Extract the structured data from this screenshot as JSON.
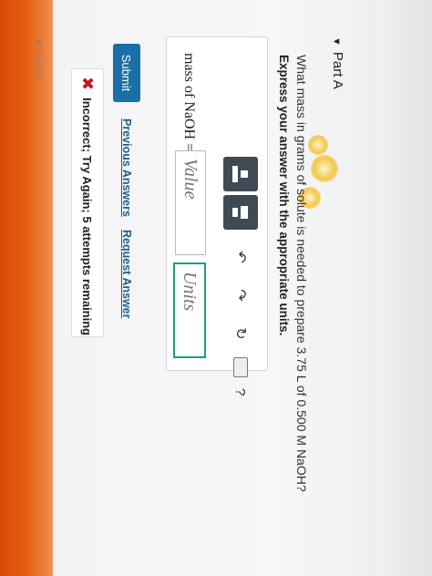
{
  "part_a": {
    "label": "Part A"
  },
  "question": {
    "text": "What mass in grams of solute is needed to prepare 3.75 L of 0.500 M NaOH?",
    "instruction": "Express your answer with the appropriate units."
  },
  "toolbar": {
    "template_icon": "templates-icon",
    "undo_icon": "undo-icon",
    "redo_icon": "redo-icon",
    "reset_icon": "reset-icon",
    "keyboard_icon": "keyboard-icon",
    "help_label": "?"
  },
  "answer": {
    "field_label": "mass of NaOH =",
    "value_placeholder": "Value",
    "units_placeholder": "Units"
  },
  "actions": {
    "submit_label": "Submit",
    "previous_answers_label": "Previous Answers",
    "request_answer_label": "Request Answer"
  },
  "feedback": {
    "text": "Incorrect; Try Again; 5 attempts remaining"
  },
  "part_b": {
    "label": "Part B"
  },
  "colors": {
    "submit": "#1b6fa6",
    "units_border": "#1a9e86",
    "error": "#c4161c",
    "bezel": "#e35d10"
  }
}
